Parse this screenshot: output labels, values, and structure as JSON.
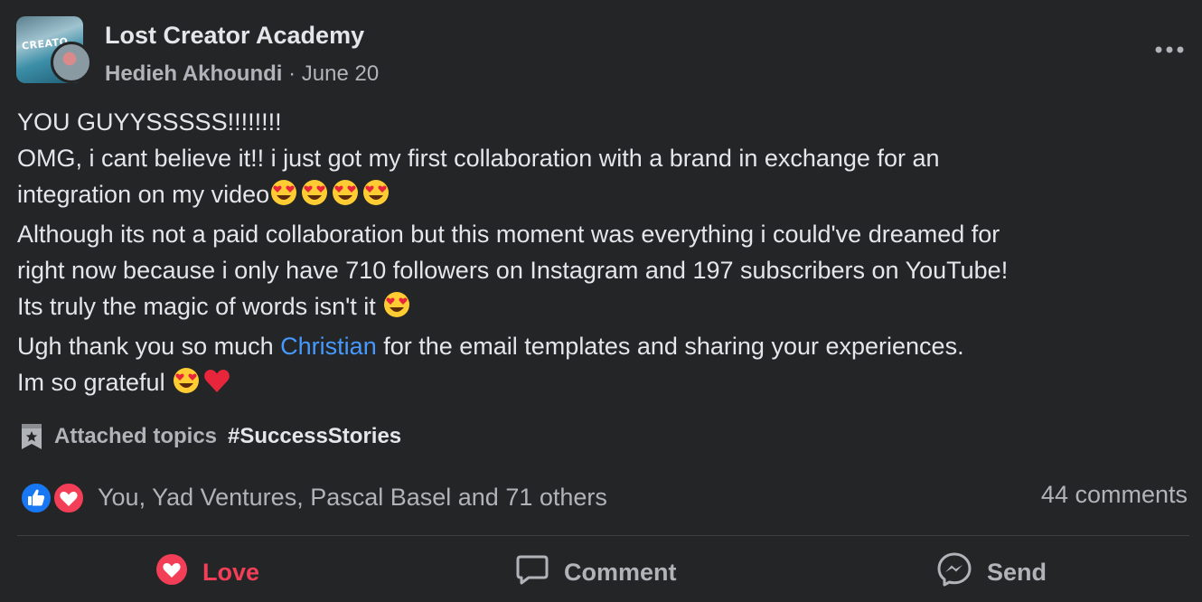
{
  "post": {
    "group_name": "Lost Creator Academy",
    "group_avatar_text": "CREATO",
    "author": "Hedieh Akhoundi",
    "separator": " · ",
    "date": "June 20",
    "more_icon": "more-horizontal-icon"
  },
  "body": {
    "line1": "YOU GUYYSSSSS!!!!!!!!",
    "line2": "OMG, i cant believe it!! i just got my first collaboration with a brand in exchange for an",
    "line3": "integration on my video",
    "line4": "Although its not a paid collaboration but this moment was everything i could've dreamed for",
    "line5": "right now because i only have 710 followers on Instagram and 197 subscribers on YouTube!",
    "line6": "Its truly the magic of words isn't it ",
    "line7_before": "Ugh thank you so much ",
    "line7_mention": "Christian",
    "line7_after": " for the email templates and sharing your experiences.",
    "line8": "Im so grateful "
  },
  "topics": {
    "icon": "badge-star-icon",
    "label": "Attached topics",
    "tag": "#SuccessStories"
  },
  "reactions": {
    "icons": [
      "like-reaction-icon",
      "love-reaction-icon"
    ],
    "summary": "You, Yad Ventures, Pascal Basel and 71 others",
    "comments": "44 comments"
  },
  "actions": {
    "love_label": "Love",
    "comment_label": "Comment",
    "send_label": "Send"
  },
  "colors": {
    "background": "#242526",
    "primary_text": "#e4e6eb",
    "secondary_text": "#b0b3b8",
    "mention": "#4599ff",
    "love": "#f33e58",
    "like": "#1877f2"
  }
}
